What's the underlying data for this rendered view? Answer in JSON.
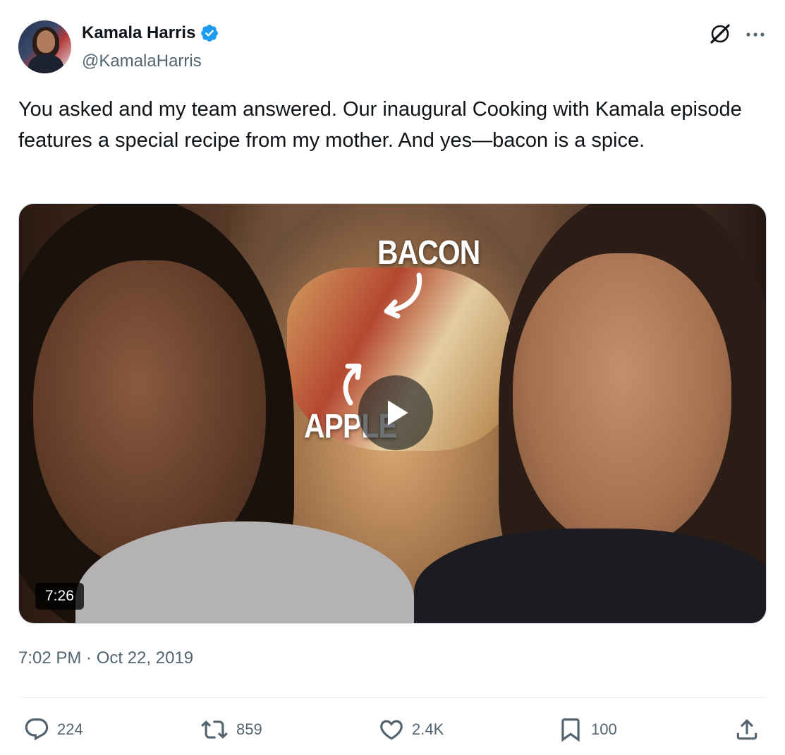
{
  "author": {
    "display_name": "Kamala Harris",
    "handle": "@KamalaHarris",
    "verified": true,
    "verified_color": "#1d9bf0"
  },
  "tweet": {
    "text": "You asked and my team answered. Our inaugural Cooking with Kamala episode features a special recipe from my mother. And yes—bacon is a spice.",
    "timestamp": "7:02 PM · Oct 22, 2019"
  },
  "media": {
    "type": "video",
    "overlay_labels": [
      "BACON",
      "APPLE"
    ],
    "duration": "7:26",
    "play_icon": "play-icon"
  },
  "header_icons": {
    "grok": "grok-icon",
    "more": "more-icon"
  },
  "actions": {
    "reply_count": "224",
    "retweet_count": "859",
    "like_count": "2.4K",
    "bookmark_count": "100",
    "icons": [
      "reply-icon",
      "retweet-icon",
      "like-icon",
      "bookmark-icon",
      "share-icon"
    ]
  },
  "colors": {
    "text_primary": "#0f1419",
    "text_secondary": "#536471",
    "divider": "#eff3f4"
  }
}
